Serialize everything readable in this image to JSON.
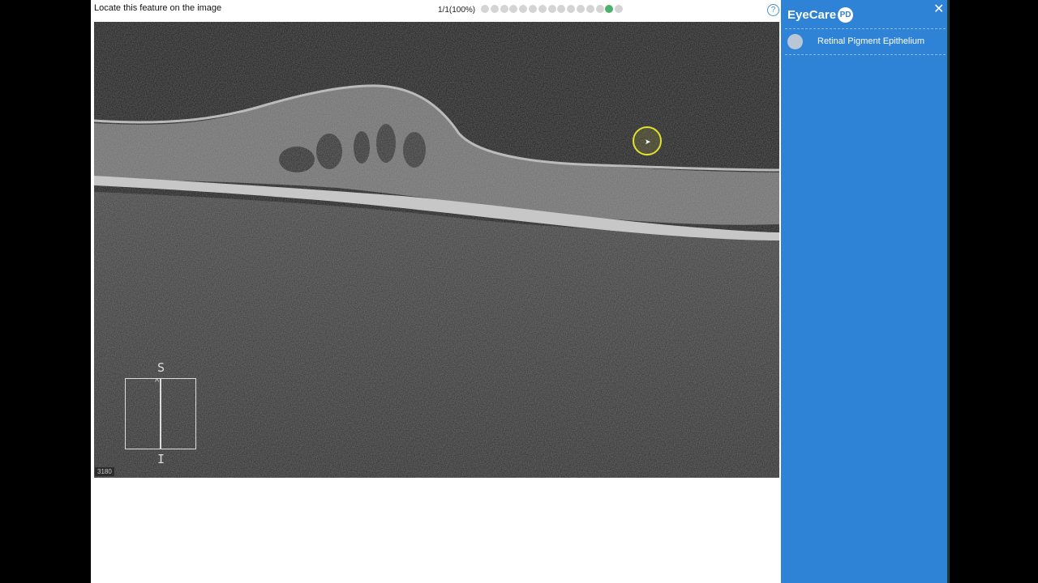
{
  "header": {
    "instruction": "Locate this feature on the image",
    "progress": "1/1(100%)",
    "dots_total": 15,
    "dots_active_index": 13,
    "help_symbol": "?"
  },
  "viewer": {
    "orientation_top": "S",
    "orientation_bottom": "I",
    "scan_id": "3180"
  },
  "sidebar": {
    "brand": "EyeCare",
    "brand_badge": "PD",
    "close_symbol": "✕",
    "features": [
      {
        "label": "Retinal Pigment Epithelium"
      }
    ]
  },
  "colors": {
    "sidebar": "#2f83d6",
    "dot_active": "#4caf6d",
    "dot_inactive": "#d4d4d4",
    "cursor_ring": "#e1e12e"
  }
}
